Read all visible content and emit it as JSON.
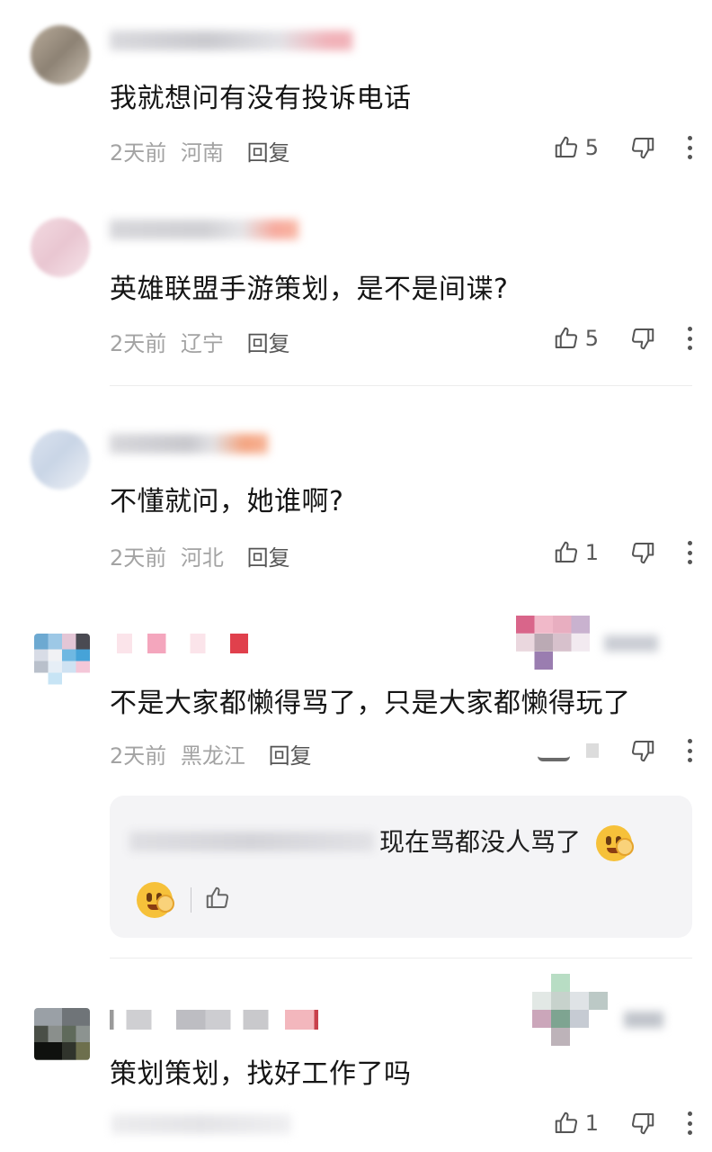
{
  "comments": [
    {
      "text": "我就想问有没有投诉电话",
      "time": "2天前",
      "location": "河南",
      "reply": "回复",
      "likes": "5"
    },
    {
      "text": "英雄联盟手游策划，是不是间谍?",
      "time": "2天前",
      "location": "辽宁",
      "reply": "回复",
      "likes": "5"
    },
    {
      "text": "不懂就问，她谁啊?",
      "time": "2天前",
      "location": "河北",
      "reply": "回复",
      "likes": "1"
    },
    {
      "text": "不是大家都懒得骂了，只是大家都懒得玩了",
      "time": "2天前",
      "location": "黑龙江",
      "reply": "回复",
      "likes": ""
    },
    {
      "text": "策划策划，找好工作了吗",
      "likes": "1"
    }
  ],
  "nested_reply": {
    "text": "现在骂都没人骂了"
  },
  "colors": {
    "meta": "#a3a3a3",
    "reply_bg": "#f4f4f6",
    "text": "#151515"
  },
  "icons": [
    "thumbs-up-icon",
    "thumbs-down-icon",
    "more-icon",
    "smiley-emoji"
  ]
}
